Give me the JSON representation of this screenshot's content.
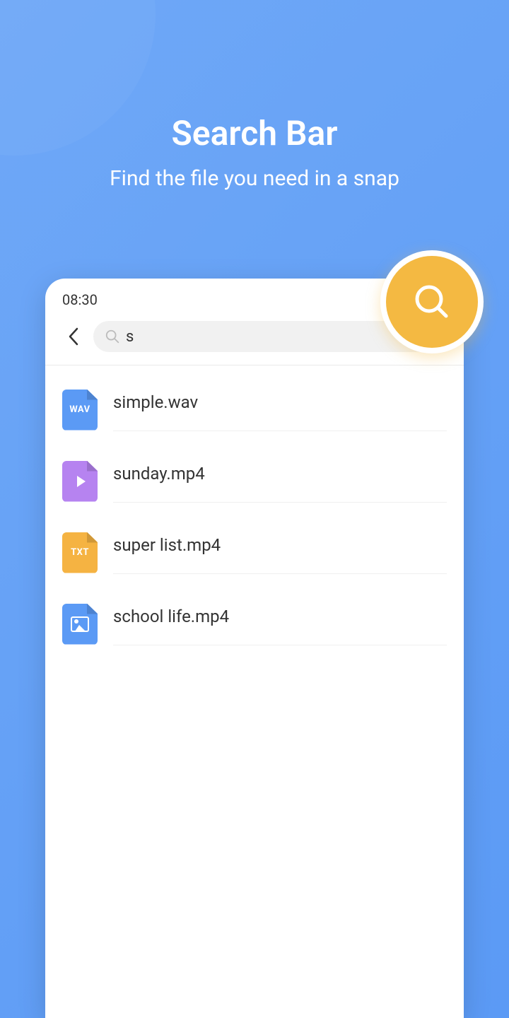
{
  "hero": {
    "title": "Search Bar",
    "subtitle": "Find the file you need in a snap"
  },
  "status": {
    "time": "08:30"
  },
  "search": {
    "value": "s"
  },
  "results": [
    {
      "name": "simple.wav",
      "type": "wav",
      "icon_label": "WAV"
    },
    {
      "name": "sunday.mp4",
      "type": "mp4",
      "icon_label": ""
    },
    {
      "name": "super list.mp4",
      "type": "txt",
      "icon_label": "TXT"
    },
    {
      "name": "school life.mp4",
      "type": "img",
      "icon_label": ""
    }
  ]
}
